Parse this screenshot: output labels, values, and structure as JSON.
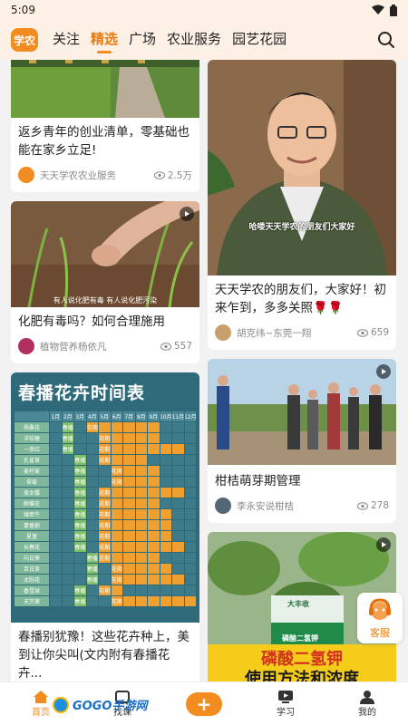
{
  "status": {
    "time": "5:09"
  },
  "header": {
    "logo_text": "学农",
    "tabs": [
      "关注",
      "精选",
      "广场",
      "农业服务",
      "园艺花园"
    ],
    "active_tab": 1
  },
  "cards": {
    "c1": {
      "title": "返乡青年的创业清单，零基础也能在家乡立足!",
      "author": "天天学农农业服务",
      "views": "2.5万",
      "avatar_text": "学农"
    },
    "c2": {
      "title": "化肥有毒吗？如何合理施用",
      "author": "植物营养杨依凡",
      "views": "557",
      "caption": "有人说化肥有毒 有人说化肥污染"
    },
    "c3": {
      "title": "春播别犹豫！这些花卉种上，美到让你尖叫(文内附有春播花卉...",
      "table_title": "春播花卉时间表",
      "months": [
        "1月",
        "2月",
        "3月",
        "4月",
        "5月",
        "6月",
        "7月",
        "8月",
        "9月",
        "10月",
        "11月",
        "12月"
      ],
      "rows": [
        "杨桑花",
        "洋桔梗",
        "一串红",
        "孔雀草",
        "麦秆菊",
        "翠菊",
        "美女樱",
        "醉蝶花",
        "矮牵牛",
        "藿香蓟",
        "夏堇",
        "长春花",
        "向日葵",
        "百日草",
        "太阳花",
        "香雪球",
        "天竺葵"
      ],
      "sow_label": "春播",
      "bloom_label": "花期",
      "end_label": "至可用"
    },
    "c4": {
      "title": "天天学农的朋友们，大家好！初来乍到，多多关照🌹🌹",
      "author": "胡克纬~东莞一翔",
      "views": "659",
      "caption": "哈喽天天学农的朋友们大家好"
    },
    "c5": {
      "title": "柑桔萌芽期管理",
      "author": "李永安说柑桔",
      "views": "278"
    },
    "c6": {
      "caption_line1": "磷酸二氢钾",
      "caption_line2": "使用方法和浓度",
      "bag_text": "磷酸二氢钾",
      "brand": "大丰收"
    }
  },
  "service": {
    "label": "客服"
  },
  "watermark": {
    "text": "GOGO手游网"
  },
  "bottom_nav": {
    "items": [
      {
        "label": "首页"
      },
      {
        "label": "找课"
      },
      {
        "label": "+"
      },
      {
        "label": "学习"
      },
      {
        "label": "我的"
      }
    ]
  },
  "colors": {
    "accent": "#f28b20",
    "header_bg": "#fdf1e6"
  }
}
